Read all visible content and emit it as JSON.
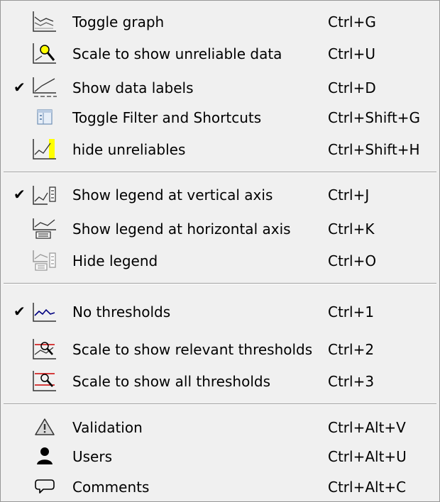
{
  "menu": {
    "items": [
      {
        "label": "Toggle graph",
        "shortcut": "Ctrl+G",
        "checked": false,
        "icon": "graph-toggle-icon"
      },
      {
        "label": "Scale to show unreliable data",
        "shortcut": "Ctrl+U",
        "checked": false,
        "icon": "scale-unreliable-icon"
      },
      {
        "label": "Show data labels",
        "shortcut": "Ctrl+D",
        "checked": true,
        "icon": "data-labels-icon"
      },
      {
        "label": "Toggle Filter and Shortcuts",
        "shortcut": "Ctrl+Shift+G",
        "checked": false,
        "icon": "filter-shortcuts-icon"
      },
      {
        "label": "hide unreliables",
        "shortcut": "Ctrl+Shift+H",
        "checked": false,
        "icon": "hide-unreliables-icon"
      },
      {
        "label": "Show legend at vertical axis",
        "shortcut": "Ctrl+J",
        "checked": true,
        "icon": "legend-vertical-icon"
      },
      {
        "label": "Show legend at horizontal axis",
        "shortcut": "Ctrl+K",
        "checked": false,
        "icon": "legend-horizontal-icon"
      },
      {
        "label": "Hide legend",
        "shortcut": "Ctrl+O",
        "checked": false,
        "icon": "hide-legend-icon"
      },
      {
        "label": "No thresholds",
        "shortcut": "Ctrl+1",
        "checked": true,
        "icon": "no-thresholds-icon"
      },
      {
        "label": "Scale to show relevant thresholds",
        "shortcut": "Ctrl+2",
        "checked": false,
        "icon": "relevant-thresholds-icon"
      },
      {
        "label": "Scale to show all thresholds",
        "shortcut": "Ctrl+3",
        "checked": false,
        "icon": "all-thresholds-icon"
      },
      {
        "label": "Validation",
        "shortcut": "Ctrl+Alt+V",
        "checked": false,
        "icon": "warning-icon"
      },
      {
        "label": "Users",
        "shortcut": "Ctrl+Alt+U",
        "checked": false,
        "icon": "user-icon"
      },
      {
        "label": "Comments",
        "shortcut": "Ctrl+Alt+C",
        "checked": false,
        "icon": "comment-icon"
      }
    ],
    "check_glyph": "✔",
    "colors": {
      "highlight": "#ffff00",
      "threshold": "#cc0000",
      "line": "#000080"
    }
  }
}
